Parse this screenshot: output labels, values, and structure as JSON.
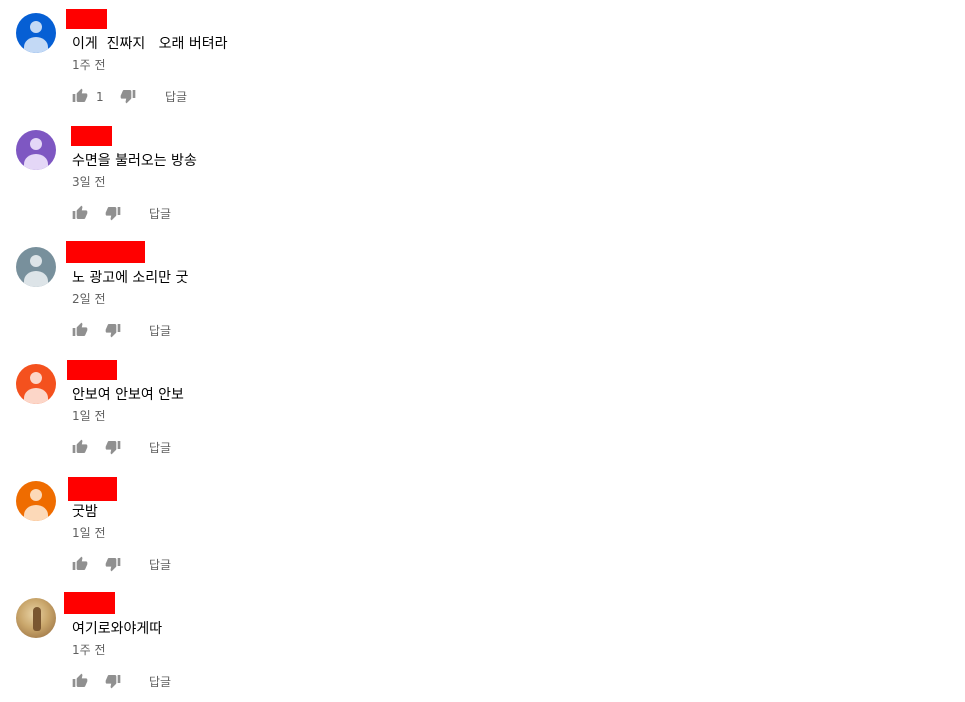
{
  "reply_label": "답글",
  "colors": {
    "redaction": "#ff0000",
    "text_primary": "#030303",
    "text_secondary": "#606060",
    "icon": "#909090"
  },
  "comments": [
    {
      "text": "이게  진짜지   오래 버텨라",
      "time": "1주 전",
      "likes": "1",
      "avatar": {
        "bg": "#065fd4",
        "head": "#c3d9f5",
        "body": "#c3d9f5"
      }
    },
    {
      "text": "수면을 불러오는 방송",
      "time": "3일 전",
      "likes": "",
      "avatar": {
        "bg": "#7e57c2",
        "head": "#e4d7f7",
        "body": "#e4d7f7"
      }
    },
    {
      "text": "노 광고에 소리만 굿",
      "time": "2일 전",
      "likes": "",
      "avatar": {
        "bg": "#78909c",
        "head": "#dde4e8",
        "body": "#dde4e8"
      }
    },
    {
      "text": "안보여 안보여 안보",
      "time": "1일 전",
      "likes": "",
      "avatar": {
        "bg": "#f4511e",
        "head": "#fcd6c8",
        "body": "#fcd6c8"
      }
    },
    {
      "text": "굿밤",
      "time": "1일 전",
      "likes": "",
      "avatar": {
        "bg": "#ef6c00",
        "head": "#fcd9b8",
        "body": "#fcd9b8"
      }
    },
    {
      "text": "여기로와야게따",
      "time": "1주 전",
      "likes": "",
      "avatar": {
        "photo": true
      }
    }
  ]
}
